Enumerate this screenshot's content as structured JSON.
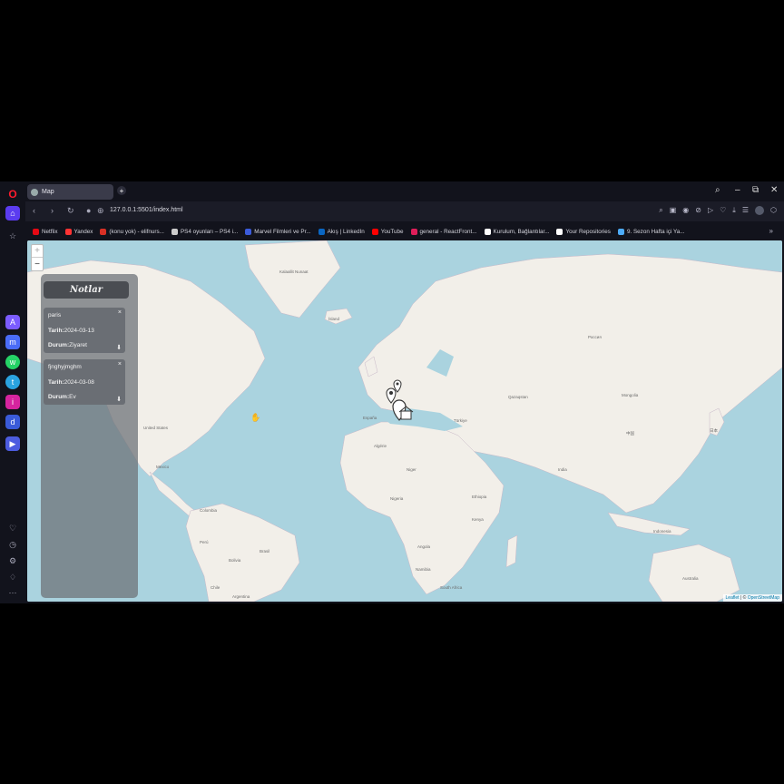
{
  "browser": {
    "tab_title": "Map",
    "new_tab_glyph": "+",
    "url": "127.0.0.1:5501/index.html",
    "window_controls": {
      "search": "⌕",
      "minimize": "–",
      "restore": "⧉",
      "close": "✕"
    }
  },
  "bookmarks": [
    {
      "label": "Netflix",
      "color": "#e50914"
    },
    {
      "label": "Yandex",
      "color": "#ff3333"
    },
    {
      "label": "(konu yok) - elifnurs...",
      "color": "#d93025"
    },
    {
      "label": "PS4 oyunları – PS4 i...",
      "color": "#cccccc"
    },
    {
      "label": "Marvel Filmleri ve Pr...",
      "color": "#3b5bdb"
    },
    {
      "label": "Akış | LinkedIn",
      "color": "#0a66c2"
    },
    {
      "label": "YouTube",
      "color": "#ff0000"
    },
    {
      "label": "general - ReactFront...",
      "color": "#e01e5a"
    },
    {
      "label": "Kurulum, Bağlantılar...",
      "color": "#ffffff"
    },
    {
      "label": "Your Repositories",
      "color": "#ffffff"
    },
    {
      "label": "9. Sezon Hafta içi Ya...",
      "color": "#4dabf7"
    }
  ],
  "bookmarks_more": "»",
  "map": {
    "zoom_in": "+",
    "zoom_out": "−",
    "attribution_leaflet": "Leaflet",
    "attribution_sep": " | © ",
    "attribution_osm": "OpenStreetMap",
    "labels": [
      {
        "text": "Kalaallit Nunaat",
        "name": "label-greenland"
      },
      {
        "text": "Ísland",
        "name": "label-iceland"
      },
      {
        "text": "Россия",
        "name": "label-russia"
      },
      {
        "text": "United States",
        "name": "label-usa"
      },
      {
        "text": "España",
        "name": "label-spain"
      },
      {
        "text": "Türkiye",
        "name": "label-turkey"
      },
      {
        "text": "Algérie",
        "name": "label-algeria"
      },
      {
        "text": "Niger",
        "name": "label-niger"
      },
      {
        "text": "Nigeria",
        "name": "label-nigeria"
      },
      {
        "text": "Brasil",
        "name": "label-brazil"
      },
      {
        "text": "Colombia",
        "name": "label-colombia"
      },
      {
        "text": "Perú",
        "name": "label-peru"
      },
      {
        "text": "Bolivia",
        "name": "label-bolivia"
      },
      {
        "text": "Chile",
        "name": "label-chile"
      },
      {
        "text": "Argentina",
        "name": "label-argentina"
      },
      {
        "text": "South Africa",
        "name": "label-south-africa"
      },
      {
        "text": "Qazaqstan",
        "name": "label-kazakhstan"
      },
      {
        "text": "Mongolia",
        "name": "label-mongolia"
      },
      {
        "text": "India",
        "name": "label-india"
      },
      {
        "text": "中国",
        "name": "label-china"
      },
      {
        "text": "日本",
        "name": "label-japan"
      },
      {
        "text": "Indonesia",
        "name": "label-indonesia"
      },
      {
        "text": "Australia",
        "name": "label-australia"
      },
      {
        "text": "Ethiopia",
        "name": "label-ethiopia"
      },
      {
        "text": "Kenya",
        "name": "label-kenya"
      },
      {
        "text": "Angola",
        "name": "label-angola"
      },
      {
        "text": "Namibia",
        "name": "label-namibia"
      },
      {
        "text": "Mexico",
        "name": "label-mexico"
      }
    ]
  },
  "notes": {
    "title": "Notlar",
    "date_label": "Tarih:",
    "status_label": "Durum:",
    "close_glyph": "×",
    "download_glyph": "⬇",
    "items": [
      {
        "title": "paris",
        "date": "2024-03-13",
        "status": "Ziyaret"
      },
      {
        "title": "fjnghyjmghm",
        "date": "2024-03-08",
        "status": "Ev"
      }
    ]
  }
}
